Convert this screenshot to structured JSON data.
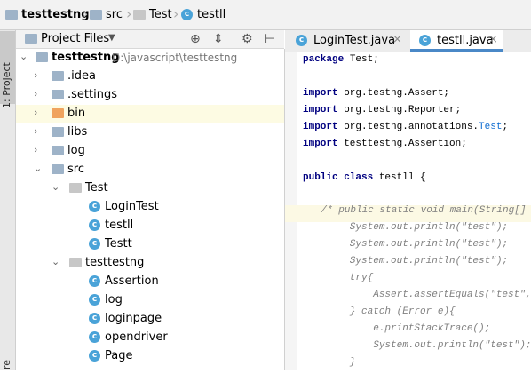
{
  "breadcrumb": {
    "items": [
      "testtestng",
      "src",
      "Test",
      "testll"
    ]
  },
  "sidebar": {
    "stripe_label": "1: Project",
    "bottom_label": "re"
  },
  "project_panel": {
    "title": "Project Files",
    "dropdown_icon": "chevron-down-icon"
  },
  "tree": {
    "root": {
      "name": "testtestng",
      "path": "D:\\javascript\\testtestng"
    },
    "items": [
      {
        "label": ".idea",
        "type": "folder"
      },
      {
        "label": ".settings",
        "type": "folder"
      },
      {
        "label": "bin",
        "type": "folder-orange"
      },
      {
        "label": "libs",
        "type": "folder"
      },
      {
        "label": "log",
        "type": "folder"
      },
      {
        "label": "src",
        "type": "folder"
      },
      {
        "label": "Test",
        "type": "package"
      },
      {
        "label": "LoginTest",
        "type": "class"
      },
      {
        "label": "testll",
        "type": "class"
      },
      {
        "label": "Testt",
        "type": "class"
      },
      {
        "label": "testtestng",
        "type": "package"
      },
      {
        "label": "Assertion",
        "type": "class"
      },
      {
        "label": "log",
        "type": "class"
      },
      {
        "label": "loginpage",
        "type": "class"
      },
      {
        "label": "opendriver",
        "type": "class"
      },
      {
        "label": "Page",
        "type": "class"
      }
    ]
  },
  "tabs": [
    {
      "label": "LoginTest.java",
      "active": false
    },
    {
      "label": "testll.java",
      "active": true
    }
  ],
  "code": {
    "l1_kw": "package",
    "l1_rest": " Test;",
    "l3_kw": "import",
    "l3_rest": " org.testng.Assert;",
    "l4_kw": "import",
    "l4_rest": " org.testng.Reporter;",
    "l5_kw": "import",
    "l5_rest": " org.testng.annotations.",
    "l5_ann": "Test",
    "l5_end": ";",
    "l6_kw": "import",
    "l6_rest": " testtestng.Assertion;",
    "l8_kw1": "public",
    "l8_kw2": "class",
    "l8_rest": " testll {",
    "l10": "    /* public static void main(String[] args",
    "l11": "        System.out.println(\"test\");",
    "l12": "        System.out.println(\"test\");",
    "l13": "        System.out.println(\"test\");",
    "l14": "        try{",
    "l15": "            Assert.assertEquals(\"test\",",
    "l16": "        } catch (Error e){",
    "l17": "            e.printStackTrace();",
    "l18": "            System.out.println(\"test\");",
    "l19": "        }"
  },
  "colors": {
    "accent": "#4a88c7",
    "class_icon": "#4aa3d8",
    "folder_icon": "#9eb3c8",
    "folder_orange": "#f0a35e",
    "package_icon": "#c7c7c7"
  }
}
